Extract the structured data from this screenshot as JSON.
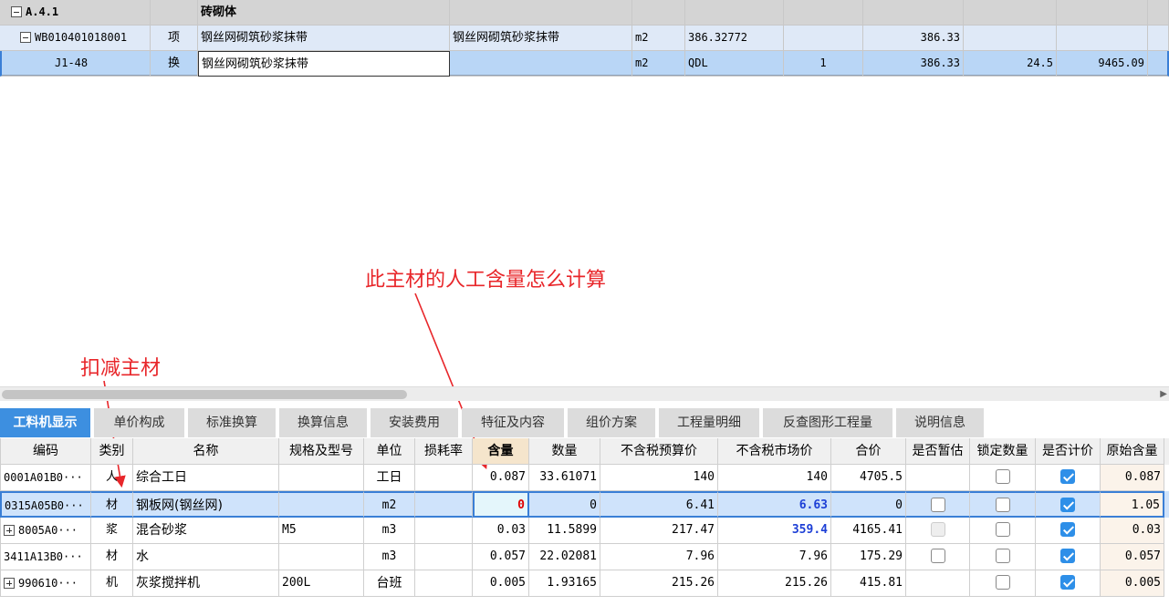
{
  "top_grid": {
    "rows": [
      {
        "code": "A.4.1",
        "name": "砖砌体"
      },
      {
        "code": "WB010401018001",
        "type": "项",
        "name": "钢丝网砌筑砂浆抹带",
        "feature": "钢丝网砌筑砂浆抹带",
        "unit": "m2",
        "qty_expr": "386.32772",
        "qty": "386.33"
      },
      {
        "code": "J1-48",
        "type": "换",
        "name": "钢丝网砌筑砂浆抹带",
        "unit": "m2",
        "qty_expr": "QDL",
        "content": "1",
        "qty": "386.33",
        "unit_price": "24.5",
        "total": "9465.09"
      }
    ]
  },
  "annotations": {
    "question": "此主材的人工含量怎么计算",
    "deduct": "扣减主材"
  },
  "tabs": [
    "工料机显示",
    "单价构成",
    "标准换算",
    "换算信息",
    "安装费用",
    "特征及内容",
    "组价方案",
    "工程量明细",
    "反查图形工程量",
    "说明信息"
  ],
  "columns": [
    "编码",
    "类别",
    "名称",
    "规格及型号",
    "单位",
    "损耗率",
    "含量",
    "数量",
    "不含税预算价",
    "不含税市场价",
    "合价",
    "是否暂估",
    "锁定数量",
    "是否计价",
    "原始含量"
  ],
  "rows": [
    {
      "code": "0001A01B0···",
      "cat": "人",
      "name": "综合工日",
      "spec": "",
      "unit": "工日",
      "loss": "",
      "content": "0.087",
      "qty": "33.61071",
      "budget": "140",
      "market": "140",
      "total": "4705.5",
      "orig": "0.087"
    },
    {
      "code": "0315A05B0···",
      "cat": "材",
      "name": "钢板网(钢丝网)",
      "spec": "",
      "unit": "m2",
      "loss": "",
      "content": "0",
      "qty": "0",
      "budget": "6.41",
      "market": "6.63",
      "total": "0",
      "orig": "1.05"
    },
    {
      "code": "8005A0···",
      "cat": "浆",
      "name": "混合砂浆",
      "spec": "M5",
      "unit": "m3",
      "loss": "",
      "content": "0.03",
      "qty": "11.5899",
      "budget": "217.47",
      "market": "359.4",
      "total": "4165.41",
      "orig": "0.03"
    },
    {
      "code": "3411A13B0···",
      "cat": "材",
      "name": "水",
      "spec": "",
      "unit": "m3",
      "loss": "",
      "content": "0.057",
      "qty": "22.02081",
      "budget": "7.96",
      "market": "7.96",
      "total": "175.29",
      "orig": "0.057"
    },
    {
      "code": "990610···",
      "cat": "机",
      "name": "灰浆搅拌机",
      "spec": "200L",
      "unit": "台班",
      "loss": "",
      "content": "0.005",
      "qty": "1.93165",
      "budget": "215.26",
      "market": "215.26",
      "total": "415.81",
      "orig": "0.005"
    }
  ],
  "colors": {
    "accent": "#3d8fe0",
    "annotation": "#e8262a",
    "highlight_blue": "#1d3fd6"
  }
}
